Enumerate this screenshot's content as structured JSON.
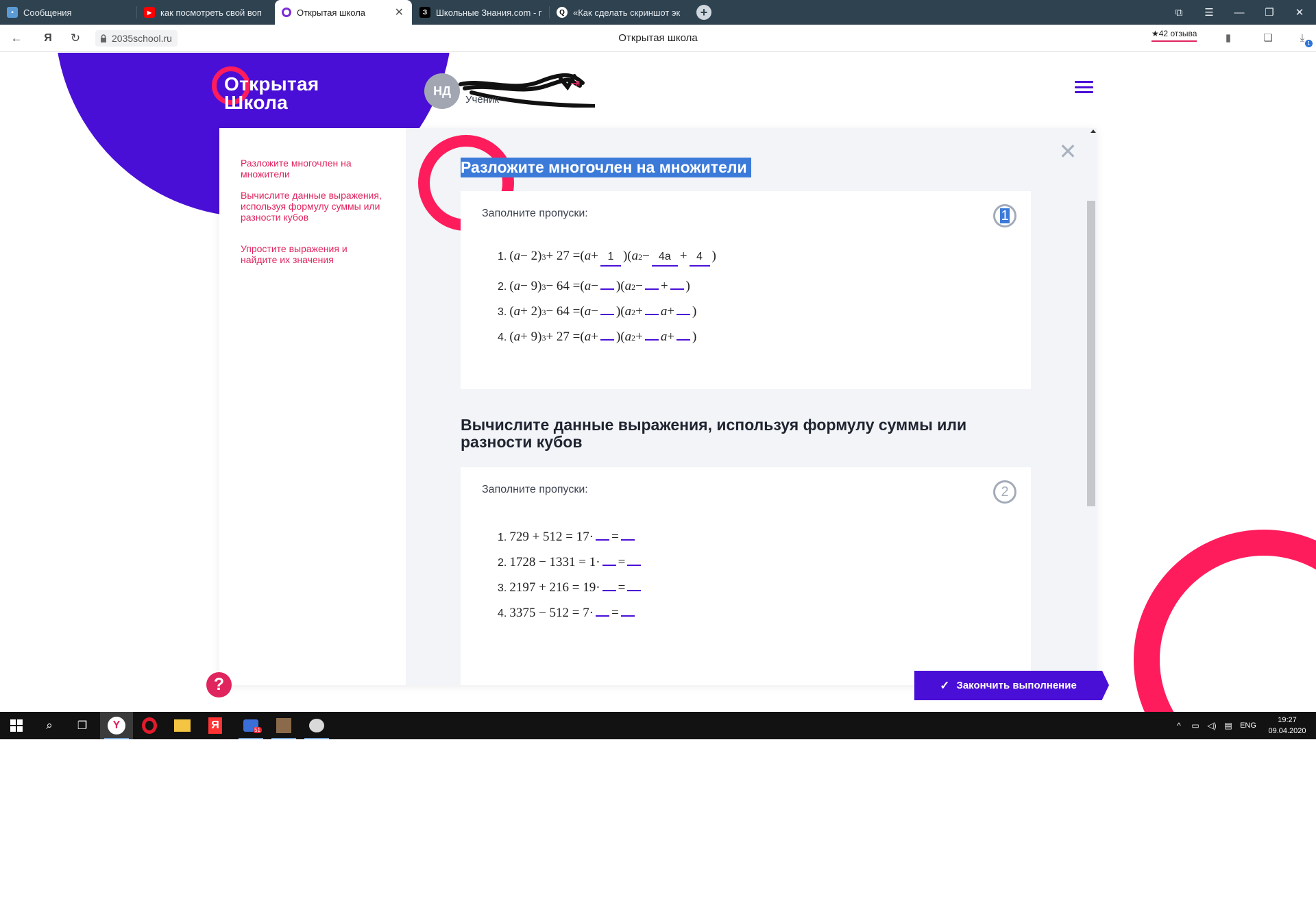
{
  "browser": {
    "tabs": [
      {
        "title": "Сообщения",
        "icon": "chat-bubble-icon",
        "active": false
      },
      {
        "title": "как посмотреть свой воп",
        "icon": "youtube-icon",
        "active": false
      },
      {
        "title": "Открытая школа",
        "icon": "open-school-icon",
        "active": true
      },
      {
        "title": "Школьные Знания.com - г",
        "icon": "znania-icon",
        "active": false
      },
      {
        "title": "«Как сделать скриншот эк",
        "icon": "yandex-q-icon",
        "active": false
      }
    ],
    "new_tab_glyph": "+",
    "url": "2035school.ru",
    "page_title": "Открытая школа",
    "reviews": "★42 отзыва",
    "downloads_badge": "1"
  },
  "site": {
    "logo_line1": "Открытая",
    "logo_line2": "Школа",
    "avatar_initials": "НД",
    "user_role": "Ученик",
    "brand_purple": "#4a0fd6",
    "brand_pink": "#ff1c5c"
  },
  "sidebar": {
    "items": [
      {
        "label": "Разложите многочлен на множители"
      },
      {
        "label": "Вычислите данные выражения, используя формулу суммы или разности кубов"
      },
      {
        "label": "Упростите выражения и найдите их значения"
      }
    ]
  },
  "sections": [
    {
      "title": "Разложите многочлен на множители",
      "hint": "Заполните пропуски:",
      "number": "1",
      "answers": [
        "1",
        "4a",
        "4"
      ]
    },
    {
      "title": "Вычислите данные выражения, используя формулу суммы или разности кубов",
      "hint": "Заполните пропуски:",
      "number": "2"
    }
  ],
  "buttons": {
    "finish": "Закончить выполнение",
    "help": "?"
  },
  "taskbar": {
    "lang": "ENG",
    "time": "19:27",
    "date": "09.04.2020",
    "mail_badge": "51"
  }
}
